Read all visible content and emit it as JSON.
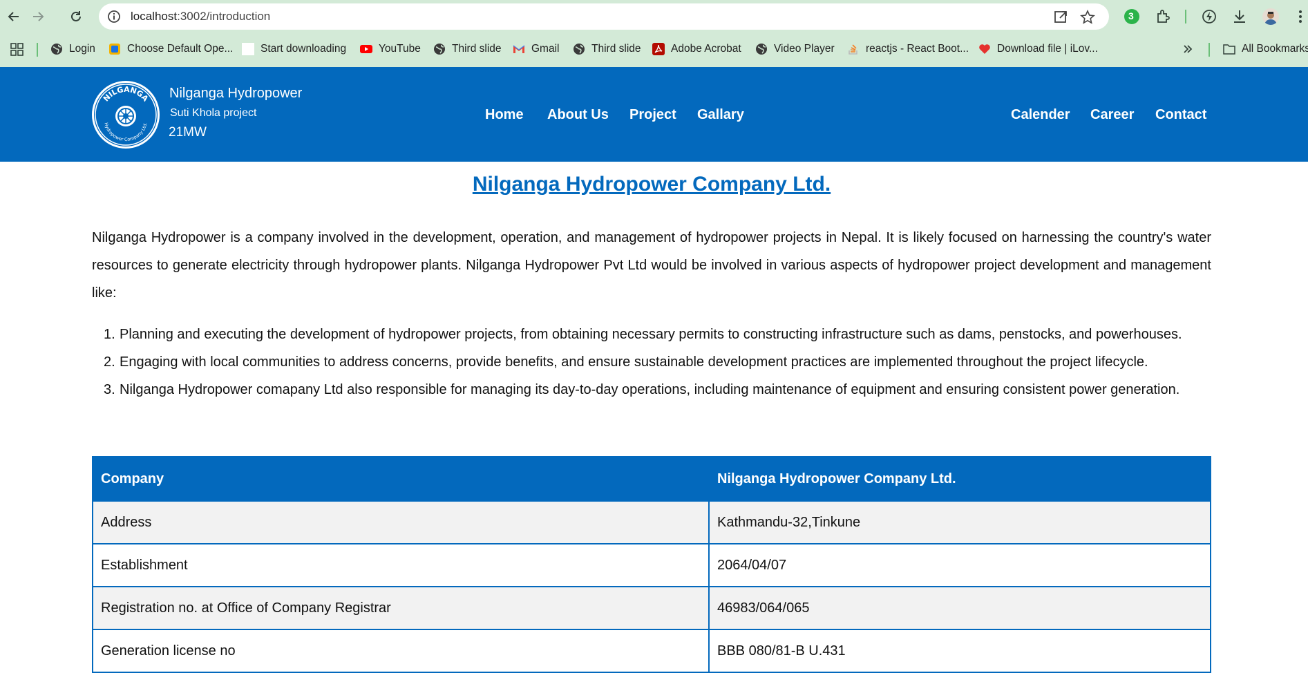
{
  "browser": {
    "url_host": "localhost",
    "url_path": ":3002/introduction",
    "bookmarks": [
      {
        "label": "Login",
        "icon": "globe-icon"
      },
      {
        "label": "Choose Default Ope...",
        "icon": "app-icon"
      },
      {
        "label": "Start downloading",
        "icon": "blank-page-icon"
      },
      {
        "label": "YouTube",
        "icon": "youtube-icon"
      },
      {
        "label": "Third slide",
        "icon": "globe-icon"
      },
      {
        "label": "Gmail",
        "icon": "gmail-icon"
      },
      {
        "label": "Third slide",
        "icon": "globe-icon"
      },
      {
        "label": "Adobe Acrobat",
        "icon": "acrobat-icon"
      },
      {
        "label": "Video Player",
        "icon": "globe-icon"
      },
      {
        "label": "reactjs - React Boot...",
        "icon": "stackoverflow-icon"
      },
      {
        "label": "Download file | iLov...",
        "icon": "heart-icon"
      }
    ],
    "all_bookmarks": "All Bookmarks",
    "extension_badge": "3"
  },
  "header": {
    "brand_name": "Nilganga Hydropower",
    "brand_project": "Suti Khola project",
    "brand_mw": "21MW",
    "logo_text": "NILGANGA",
    "logo_subtext": "Hydropower Company Ltd.",
    "nav_left": [
      "Home",
      "About Us",
      "Project",
      "Gallary"
    ],
    "nav_right": [
      "Calender",
      "Career",
      "Contact"
    ]
  },
  "main": {
    "title": "Nilganga Hydropower Company Ltd.",
    "intro": "Nilganga Hydropower is a company involved in the development, operation, and management of hydropower projects in Nepal. It is likely focused on harnessing the country's water resources to generate electricity through hydropower plants. Nilganga Hydropower Pvt Ltd would be involved in various aspects of hydropower project development and management like:",
    "list": [
      "Planning and executing the development of hydropower projects, from obtaining necessary permits to constructing infrastructure such as dams, penstocks, and powerhouses.",
      "Engaging with local communities to address concerns, provide benefits, and ensure sustainable development practices are implemented throughout the project lifecycle.",
      "Nilganga Hydropower comapany Ltd also responsible for managing its day-to-day operations, including maintenance of equipment and ensuring consistent power generation."
    ],
    "table": {
      "header": [
        "Company",
        "Nilganga Hydropower Company Ltd."
      ],
      "rows": [
        [
          "Address",
          "Kathmandu-32,Tinkune"
        ],
        [
          "Establishment",
          "2064/04/07"
        ],
        [
          "Registration no. at Office of Company Registrar",
          "46983/064/065"
        ],
        [
          "Generation license no",
          "BBB 080/81-B U.431"
        ]
      ]
    }
  },
  "colors": {
    "brand_blue": "#0369bd",
    "chrome_green": "#d3ead7"
  }
}
